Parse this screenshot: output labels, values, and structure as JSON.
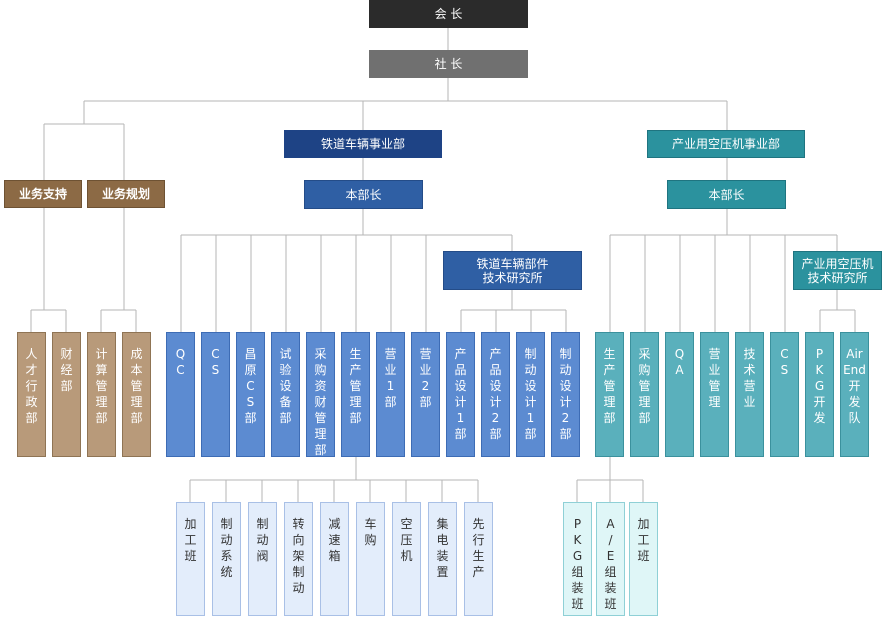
{
  "top": {
    "chairman": "会  长",
    "president": "社  长"
  },
  "left_group": {
    "support": "业务支持",
    "planning": "业务规划",
    "units": [
      "人\n才\n行\n政\n部",
      "财\n经\n部",
      "计\n算\n管\n理\n部",
      "成\n本\n管\n理\n部"
    ]
  },
  "rail_division": {
    "title": "铁道车辆事业部",
    "head": "本部长",
    "institute": "铁道车辆部件\n技术研究所",
    "units": [
      "Q\nC",
      "C\nS",
      "昌\n原\nC\nS\n部",
      "试\n验\n设\n备\n部",
      "采\n购\n资\n财\n管\n理\n部",
      "生\n产\n管\n理\n部",
      "营\n业\n1\n部",
      "营\n业\n2\n部"
    ],
    "institute_units": [
      "产\n品\n设\n计\n1\n部",
      "产\n品\n设\n计\n2\n部",
      "制\n动\n设\n计\n1\n部",
      "制\n动\n设\n计\n2\n部"
    ],
    "production_teams": [
      "加\n工\n班",
      "制\n动\n系\n统",
      "制\n动\n阀",
      "转\n向\n架\n制\n动",
      "减\n速\n箱",
      "车\n购",
      "空\n压\n机",
      "集\n电\n装\n置",
      "先\n行\n生\n产"
    ]
  },
  "comp_division": {
    "title": "产业用空压机事业部",
    "head": "本部长",
    "institute": "产业用空压机\n技术研究所",
    "units": [
      "生\n产\n管\n理\n部",
      "采\n购\n管\n理\n部",
      "Q\nA",
      "营\n业\n管\n理",
      "技\n术\n营\n业",
      "C\nS"
    ],
    "institute_units": [
      "P\nK\nG\n开\n发",
      "Air\nEnd\n开\n发\n队"
    ],
    "production_teams": [
      "P\nK\nG\n组\n装\n班",
      "A\n/\nE\n组\n装\n班",
      "加\n工\n班"
    ]
  },
  "colors": {
    "line": "#b5b5b5",
    "chairman": "#2b2b2b",
    "president": "#707070",
    "support": "#8c6a45",
    "rail": "#1e4385",
    "compressor": "#2b929e"
  }
}
